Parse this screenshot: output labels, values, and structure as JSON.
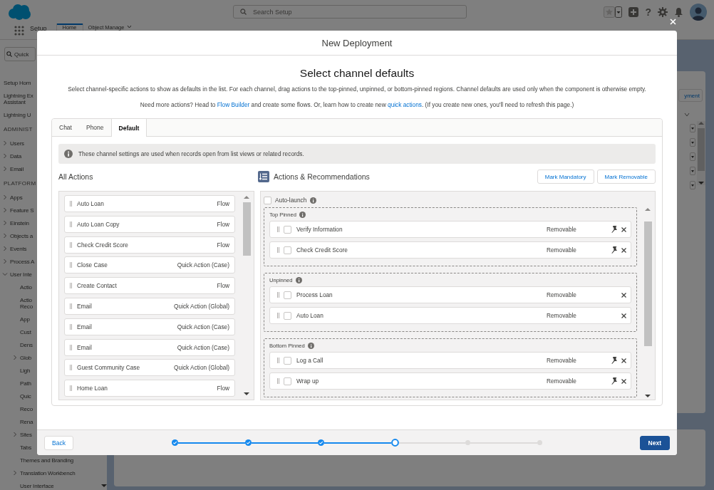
{
  "top_bar": {
    "search": {
      "placeholder": "Search Setup"
    },
    "help": "?"
  },
  "nav": {
    "app_name": "Setup",
    "tabs": [
      {
        "label": "Home",
        "selected": true
      },
      {
        "label": "Object Manage",
        "selected": false
      }
    ]
  },
  "sidebar": {
    "quick_find": {
      "placeholder": "Quick"
    },
    "items": [
      {
        "kind": "link",
        "label": "Setup Hom"
      },
      {
        "kind": "link",
        "lines": [
          "Lightning Ex",
          "Assistant"
        ]
      },
      {
        "kind": "link",
        "label": "Lightning U"
      },
      {
        "kind": "heading",
        "label": "ADMINIST"
      },
      {
        "kind": "folder",
        "label": "Users",
        "expanded": false
      },
      {
        "kind": "folder",
        "label": "Data",
        "expanded": false
      },
      {
        "kind": "folder",
        "label": "Email",
        "expanded": false
      },
      {
        "kind": "heading",
        "label": "PLATFORM"
      },
      {
        "kind": "folder",
        "label": "Apps",
        "expanded": false
      },
      {
        "kind": "folder",
        "label": "Feature S",
        "expanded": false
      },
      {
        "kind": "folder",
        "label": "Einstein",
        "expanded": false
      },
      {
        "kind": "folder",
        "label": "Objects a",
        "expanded": false
      },
      {
        "kind": "folder",
        "label": "Events",
        "expanded": false
      },
      {
        "kind": "folder",
        "label": "Process A",
        "expanded": false
      },
      {
        "kind": "folder",
        "label": "User Inte",
        "expanded": true,
        "children": [
          {
            "kind": "link",
            "label": "Actio"
          },
          {
            "kind": "link",
            "lines": [
              "Actio",
              "Reco"
            ]
          },
          {
            "kind": "link",
            "label": "App"
          },
          {
            "kind": "link",
            "label": "Cust"
          },
          {
            "kind": "link",
            "label": "Dens"
          },
          {
            "kind": "folder",
            "label": "Glob",
            "expanded": false
          },
          {
            "kind": "link",
            "label": "Ligh"
          },
          {
            "kind": "link",
            "label": "Path"
          },
          {
            "kind": "link",
            "label": "Quic"
          },
          {
            "kind": "link",
            "label": "Reco"
          },
          {
            "kind": "link",
            "label": "Rena"
          },
          {
            "kind": "folder",
            "label": "Sites",
            "expanded": false
          },
          {
            "kind": "link",
            "label": "Tabs"
          },
          {
            "kind": "link",
            "label": "Themes and Branding"
          },
          {
            "kind": "folder",
            "label": "Translation Workbench",
            "expanded": false
          },
          {
            "kind": "link",
            "label": "User Interface"
          }
        ]
      }
    ]
  },
  "main": {
    "button": "yment"
  },
  "modal": {
    "title": "New Deployment",
    "heading": "Select channel defaults",
    "description": "Select channel-specific actions to show as defaults in the list. For each channel, drag actions to the top-pinned, unpinned, or bottom-pinned regions. Channel defaults are used only when the component is otherwise empty.",
    "help": [
      {
        "kind": "text",
        "text": "Need more actions? Head to "
      },
      {
        "kind": "link",
        "text": "Flow Builder"
      },
      {
        "kind": "text",
        "text": " and create some flows. Or, learn how to create new "
      },
      {
        "kind": "link",
        "text": "quick actions"
      },
      {
        "kind": "text",
        "text": ". (If you create new ones, you'll need to refresh this page.)"
      }
    ],
    "tabs": [
      {
        "label": "Chat",
        "selected": false
      },
      {
        "label": "Phone",
        "selected": false
      },
      {
        "label": "Default",
        "selected": true
      }
    ],
    "notice": "These channel settings are used when records open from list views or related records.",
    "all_actions": {
      "title": "All Actions",
      "items": [
        {
          "name": "Auto Loan",
          "type": "Flow"
        },
        {
          "name": "Auto Loan Copy",
          "type": "Flow"
        },
        {
          "name": "Check Credit Score",
          "type": "Flow"
        },
        {
          "name": "Close Case",
          "type": "Quick Action (Case)"
        },
        {
          "name": "Create Contact",
          "type": "Flow"
        },
        {
          "name": "Email",
          "type": "Quick Action (Global)"
        },
        {
          "name": "Email",
          "type": "Quick Action (Case)"
        },
        {
          "name": "Email",
          "type": "Quick Action (Case)"
        },
        {
          "name": "Guest Community Case",
          "type": "Quick Action (Global)"
        },
        {
          "name": "Home Loan",
          "type": "Flow"
        }
      ]
    },
    "recommendations": {
      "title": "Actions & Recommendations",
      "buttons": [
        "Mark Mandatory",
        "Mark Removable"
      ],
      "auto_launch": {
        "label": "Auto-launch",
        "checked": false
      },
      "groups": [
        {
          "title": "Top Pinned",
          "items": [
            {
              "name": "Verify Information",
              "status": "Removable",
              "checked": false,
              "pinnable": true
            },
            {
              "name": "Check Credit Score",
              "status": "Removable",
              "checked": false,
              "pinnable": true
            }
          ]
        },
        {
          "title": "Unpinned",
          "items": [
            {
              "name": "Process Loan",
              "status": "Removable",
              "checked": false,
              "pinnable": false
            },
            {
              "name": "Auto Loan",
              "status": "Removable",
              "checked": false,
              "pinnable": false
            }
          ]
        },
        {
          "title": "Bottom Pinned",
          "items": [
            {
              "name": "Log a Call",
              "status": "Removable",
              "checked": false,
              "pinnable": true
            },
            {
              "name": "Wrap up",
              "status": "Removable",
              "checked": false,
              "pinnable": true
            }
          ]
        }
      ]
    },
    "footer": {
      "back": "Back",
      "next": "Next",
      "steps": [
        {
          "complete": true,
          "current": false
        },
        {
          "complete": true,
          "current": false
        },
        {
          "complete": true,
          "current": false
        },
        {
          "complete": false,
          "current": true
        },
        {
          "complete": false,
          "current": false
        },
        {
          "complete": false,
          "current": false
        }
      ]
    }
  }
}
